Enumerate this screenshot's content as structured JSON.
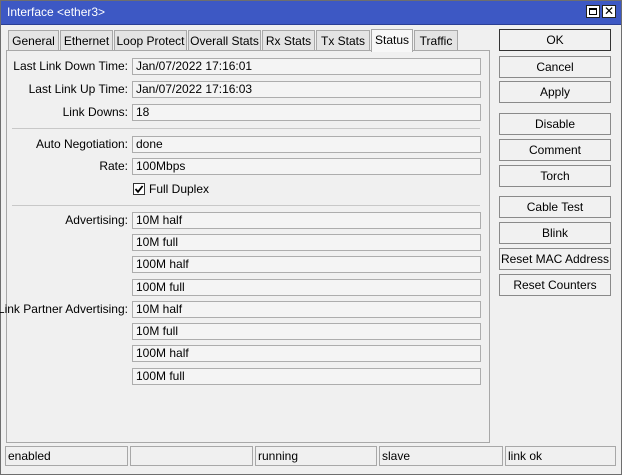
{
  "window": {
    "title": "Interface <ether3>"
  },
  "tabs": [
    {
      "label": "General"
    },
    {
      "label": "Ethernet"
    },
    {
      "label": "Loop Protect"
    },
    {
      "label": "Overall Stats"
    },
    {
      "label": "Rx Stats"
    },
    {
      "label": "Tx Stats"
    },
    {
      "label": "Status",
      "active": true
    },
    {
      "label": "Traffic"
    }
  ],
  "status": {
    "last_link_down_label": "Last Link Down Time:",
    "last_link_down": "Jan/07/2022 17:16:01",
    "last_link_up_label": "Last Link Up Time:",
    "last_link_up": "Jan/07/2022 17:16:03",
    "link_downs_label": "Link Downs:",
    "link_downs": "18",
    "auto_negotiation_label": "Auto Negotiation:",
    "auto_negotiation": "done",
    "rate_label": "Rate:",
    "rate": "100Mbps",
    "full_duplex_label": "Full Duplex",
    "full_duplex_checked": true,
    "advertising_label": "Advertising:",
    "advertising": [
      "10M half",
      "10M full",
      "100M half",
      "100M full"
    ],
    "link_partner_label": "Link Partner Advertising:",
    "link_partner": [
      "10M half",
      "10M full",
      "100M half",
      "100M full"
    ]
  },
  "buttons": {
    "ok": "OK",
    "cancel": "Cancel",
    "apply": "Apply",
    "disable": "Disable",
    "comment": "Comment",
    "torch": "Torch",
    "cable_test": "Cable Test",
    "blink": "Blink",
    "reset_mac": "Reset MAC Address",
    "reset_counters": "Reset Counters"
  },
  "statusbar": [
    "enabled",
    "",
    "running",
    "slave",
    "link ok"
  ],
  "icons": {
    "maximize": "maximize-icon",
    "close": "close-icon",
    "check": "checkmark-icon"
  },
  "colors": {
    "titlebar": "#3d58c4",
    "title_text": "#ffffff"
  }
}
